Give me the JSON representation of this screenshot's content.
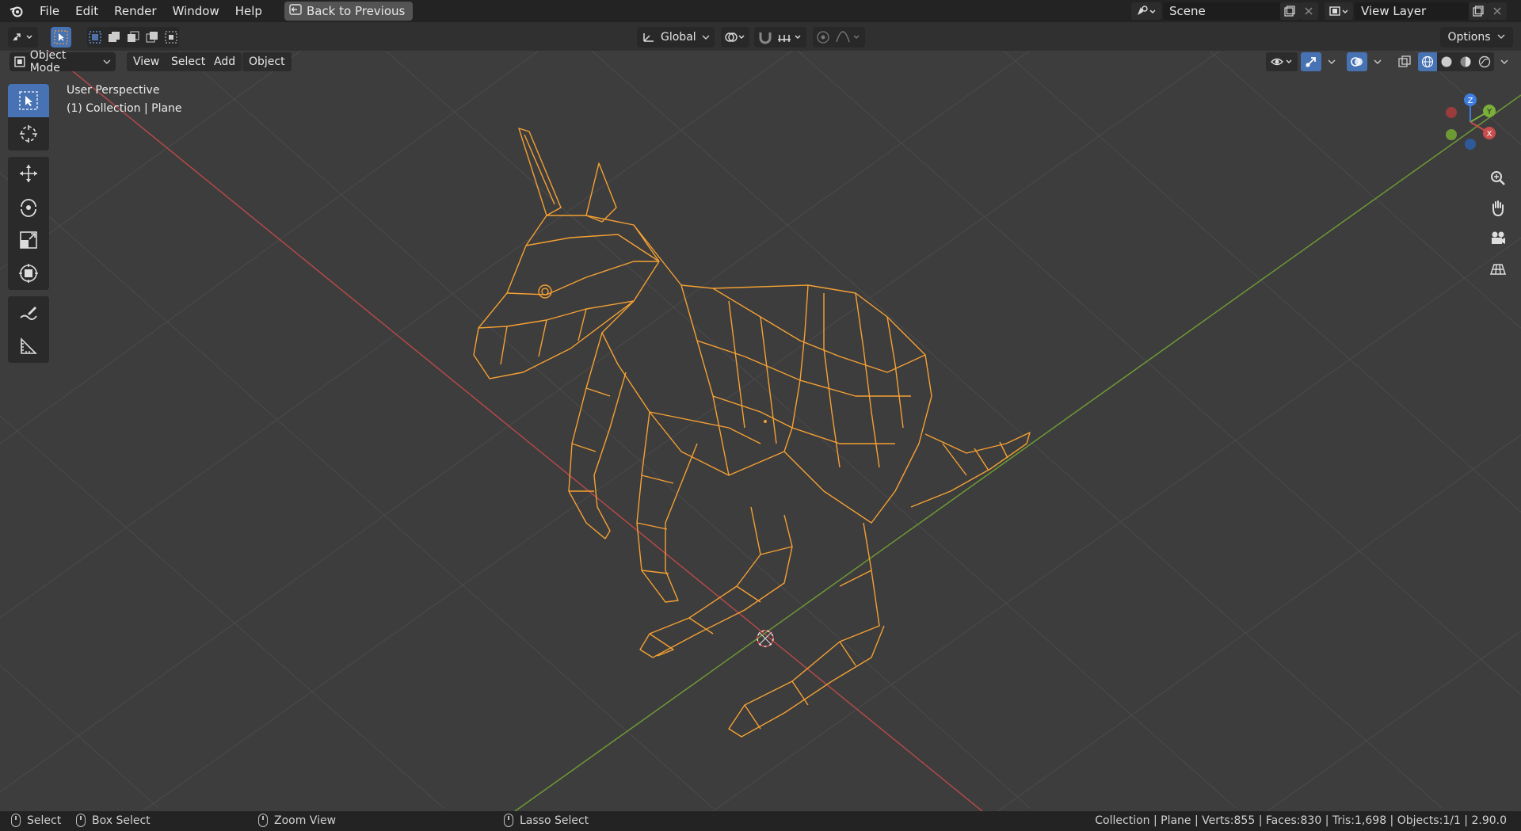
{
  "menubar": {
    "items": [
      "File",
      "Edit",
      "Render",
      "Window",
      "Help"
    ],
    "back_button": "Back to Previous",
    "scene_name": "Scene",
    "view_layer": "View Layer"
  },
  "tool_header": {
    "transform_orientation": "Global",
    "options_label": "Options"
  },
  "viewport_header": {
    "mode": "Object Mode",
    "menus": [
      "View",
      "Select",
      "Add",
      "Object"
    ]
  },
  "viewport": {
    "perspective_label": "User Perspective",
    "collection_label": "(1) Collection | Plane",
    "object_color": "#f5a033",
    "gizmo": {
      "x": "X",
      "y": "Y",
      "z": "Z"
    }
  },
  "toolbar_tools": [
    "select-box",
    "cursor",
    "move",
    "rotate",
    "scale",
    "transform",
    "annotate",
    "measure"
  ],
  "statusbar": {
    "select": "Select",
    "box_select": "Box Select",
    "zoom_view": "Zoom View",
    "lasso_select": "Lasso Select",
    "stats": "Collection | Plane | Verts:855 | Faces:830 | Tris:1,698 | Objects:1/1 | 2.90.0"
  },
  "colors": {
    "accent": "#4772b3",
    "x_axis": "#c94d4d",
    "y_axis": "#7ab03a",
    "z_axis": "#3d7ee0"
  }
}
